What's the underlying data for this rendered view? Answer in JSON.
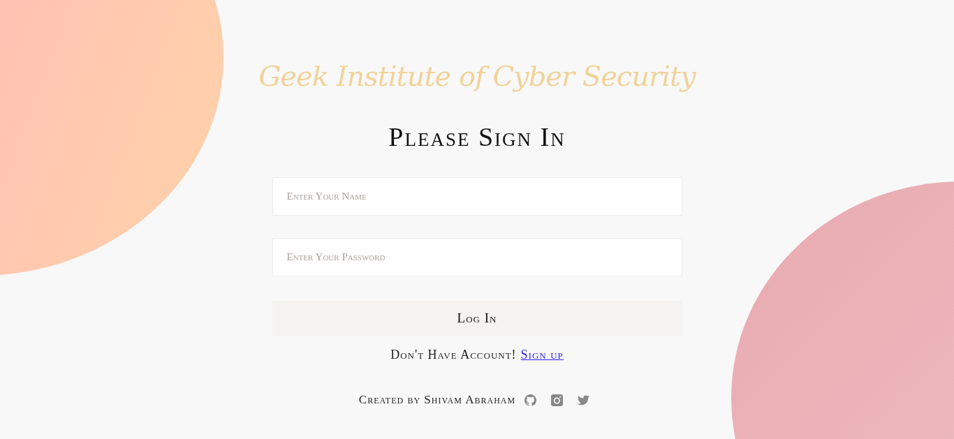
{
  "title": "Geek Institute of Cyber Security",
  "heading": "Please Sign In",
  "fields": [
    {
      "placeholder": "Enter Your Name"
    },
    {
      "placeholder": "Enter Your Password"
    }
  ],
  "button": "Log In",
  "signup": {
    "text": "Don't Have Account!",
    "link": "Sign up"
  },
  "footer": {
    "credit": "Created by Shivam Abraham"
  }
}
